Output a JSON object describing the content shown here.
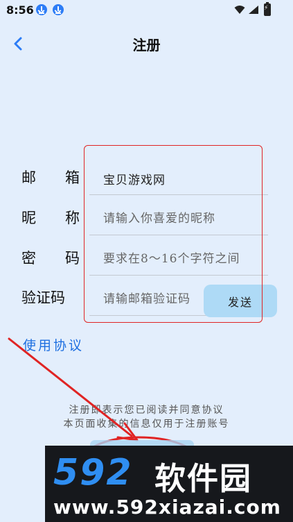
{
  "status_bar": {
    "time": "8:56",
    "icons": [
      "download-icon",
      "download-icon",
      "wifi-icon",
      "signal-icon",
      "battery-charging-icon"
    ]
  },
  "header": {
    "title": "注册",
    "back_icon": "chevron-left-icon",
    "accent_color": "#2c7cf6"
  },
  "form": {
    "email": {
      "label_chars": [
        "邮",
        "箱"
      ],
      "value": "宝贝游戏网",
      "placeholder": ""
    },
    "nickname": {
      "label_chars": [
        "昵",
        "称"
      ],
      "value": "",
      "placeholder": "请输入你喜爱的昵称"
    },
    "password": {
      "label_chars": [
        "密",
        "码"
      ],
      "value": "",
      "placeholder": "要求在8～16个字符之间"
    },
    "code": {
      "label_chars": [
        "验证码"
      ],
      "value": "",
      "placeholder": "请输邮箱验证码",
      "send_label": "发送"
    }
  },
  "agreement_link": "使用协议",
  "notice": {
    "line1": "注册即表示您已阅读并同意协议",
    "line2": "本页面收集的信息仅用于注册账号"
  },
  "watermark": {
    "brand_number": "592",
    "brand_cn": "软件园",
    "url": "www.592xiazai.com"
  },
  "annotation_color": "#e02424"
}
